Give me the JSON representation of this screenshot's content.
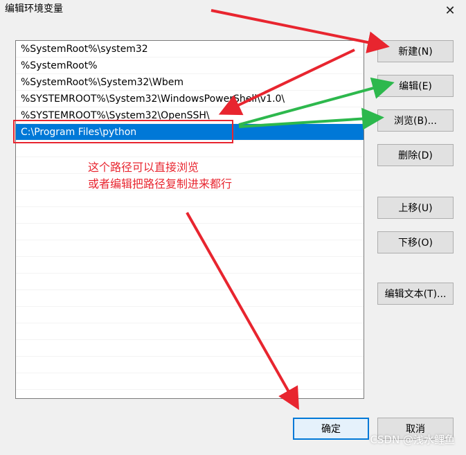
{
  "window": {
    "title": "编辑环境变量",
    "close_glyph": "✕"
  },
  "path_list": [
    "%SystemRoot%\\system32",
    "%SystemRoot%",
    "%SystemRoot%\\System32\\Wbem",
    "%SYSTEMROOT%\\System32\\WindowsPowerShell\\v1.0\\",
    "%SYSTEMROOT%\\System32\\OpenSSH\\",
    "C:\\Program Files\\python",
    "",
    "",
    "",
    "",
    "",
    "",
    "",
    "",
    "",
    "",
    "",
    "",
    "",
    "",
    ""
  ],
  "selected_index": 5,
  "buttons": {
    "new": "新建(N)",
    "edit": "编辑(E)",
    "browse": "浏览(B)...",
    "delete": "删除(D)",
    "move_up": "上移(U)",
    "move_down": "下移(O)",
    "edit_text": "编辑文本(T)...",
    "ok": "确定",
    "cancel": "取消"
  },
  "annotation": {
    "line1": "这个路径可以直接浏览",
    "line2": "或者编辑把路径复制进来都行",
    "color": "#e8252f",
    "green": "#2db84d"
  },
  "watermark": "CSDN @浅水鲤鱼"
}
